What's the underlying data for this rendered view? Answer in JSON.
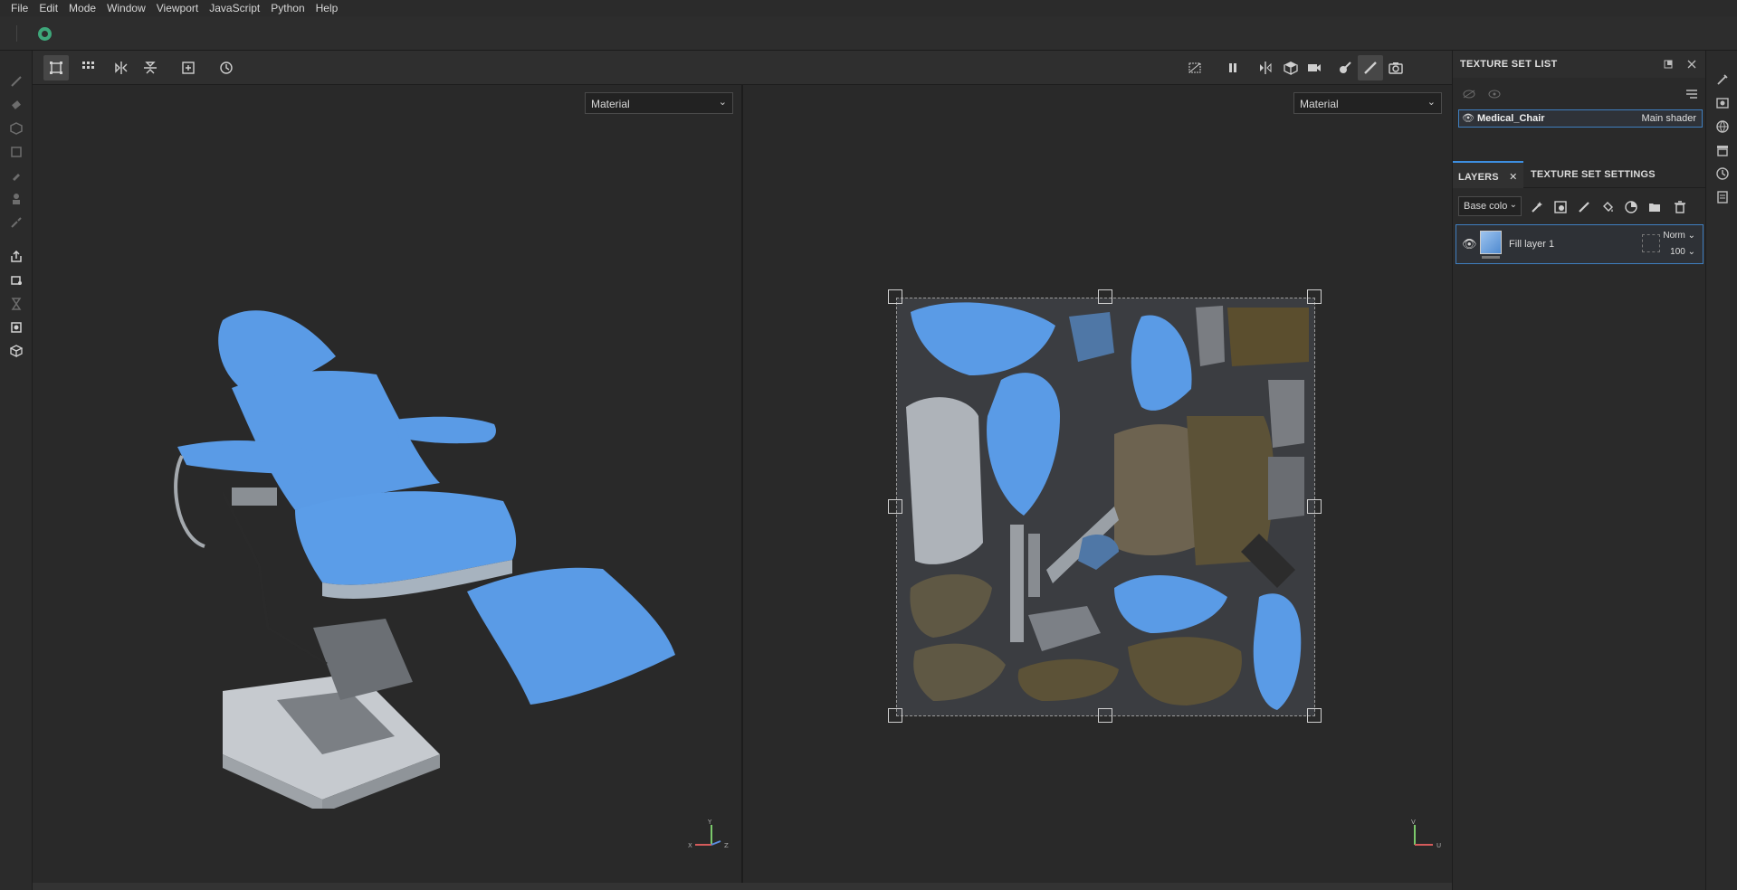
{
  "menubar": {
    "items": [
      "File",
      "Edit",
      "Mode",
      "Window",
      "Viewport",
      "JavaScript",
      "Python",
      "Help"
    ]
  },
  "viewports": {
    "left": {
      "display": "Material"
    },
    "right": {
      "display": "Material"
    }
  },
  "texture_set_list": {
    "title": "TEXTURE SET LIST",
    "items": [
      {
        "name": "Medical_Chair",
        "shader": "Main shader"
      }
    ]
  },
  "layers_panel": {
    "tabs": [
      {
        "label": "LAYERS",
        "active": true
      },
      {
        "label": "TEXTURE SET SETTINGS",
        "active": false
      }
    ],
    "channel": "Base colo",
    "layers": [
      {
        "name": "Fill layer 1",
        "blend": "Norm",
        "opacity": "100"
      }
    ]
  },
  "gizmos": {
    "left": {
      "x": "X",
      "y": "Y",
      "z": "Z"
    },
    "right": {
      "v": "V",
      "u": "U"
    }
  },
  "colors": {
    "accent": "#3d8ee0",
    "chair_blue": "#5a9be6",
    "chair_base": "#c8ccd2",
    "logo_green": "#3ea77a"
  }
}
